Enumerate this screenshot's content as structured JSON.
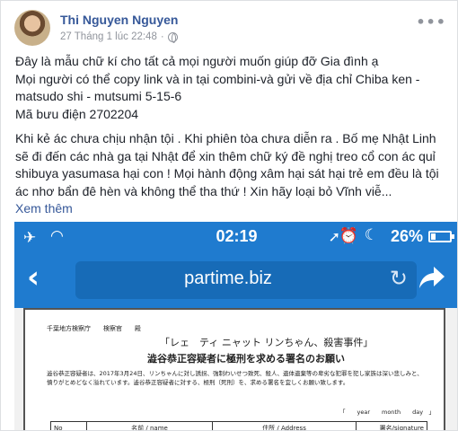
{
  "post": {
    "author": "Thi Nguyen Nguyen",
    "timestamp": "27 Tháng 1 lúc 22:48",
    "separator": "·",
    "menu_label": "•••",
    "paragraph1_line1": "Đây là mẫu chữ kí cho tất cả mọi người muốn giúp đỡ Gia đình ạ",
    "paragraph1_line2": "Mọi người có thể copy link và in tại combini-và gửi về địa chỉ Chiba ken - matsudo shi - mutsumi 5-15-6",
    "paragraph1_line3": "Mã bưu điện 2702204",
    "paragraph2": "Khi kẻ ác chưa chịu nhận tội . Khi phiên tòa chưa diễn ra . Bố mẹ Nhật Linh sẽ đi đến các nhà ga tại Nhật để xin thêm chữ ký đề nghị treo cổ con ác quỉ shibuya yasumasa hại con ! Mọi hành động xâm hại sát hại trẻ em đều là tội ác nhơ bẩn đê hèn và không thể tha thứ ! Xin hãy loại bỏ Vĩnh viễ...",
    "see_more": "Xem thêm"
  },
  "phone": {
    "status_time": "02:19",
    "battery_pct": "26%",
    "url": "partime.biz",
    "accent": "#1f7bcf"
  },
  "document": {
    "address_line": "千葉地方検察庁　　検察官　　殿",
    "title_line1": "「レェ　ティ ニャット リンちゃん、殺害事件」",
    "title_line2": "澁谷恭正容疑者に極刑を求める署名のお願い",
    "request_text": "澁谷恭正容疑者は、2017年3月24日、リンちゃんに対し誘拐、強制わいせつ致死、殺人、遺体遺棄等の卑劣な犯罪を犯し家族は深い悲しみと、憤りがとめどなく溢れています。澁谷恭正容疑者に対する、極刑（死刑）を、求める署名を宜しくお願い致します。",
    "year_month_day": "「　　year　　month　　day　」",
    "col_no": "No",
    "col_name": "名前 / name",
    "col_address": "住所 / Address",
    "col_signature": "署名/signature"
  }
}
